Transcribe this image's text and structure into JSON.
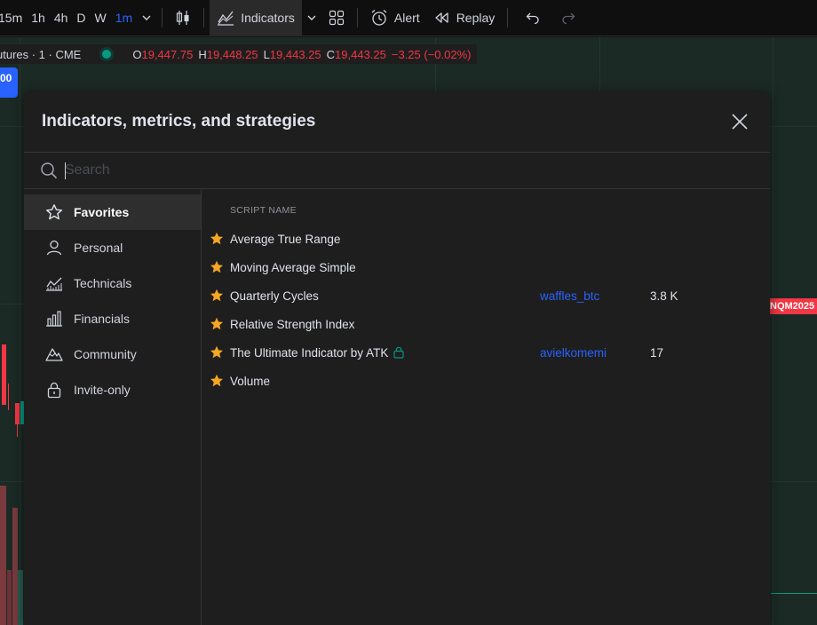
{
  "toolbar": {
    "timeframes": [
      "15m",
      "1h",
      "4h",
      "D",
      "W",
      "1m"
    ],
    "active_timeframe_index": 5,
    "indicators_label": "Indicators",
    "alert_label": "Alert",
    "replay_label": "Replay"
  },
  "chart": {
    "symbol": "utures · 1 · CME",
    "ohlc": {
      "o_key": "O",
      "o": "19,447.75",
      "h_key": "H",
      "h": "19,448.25",
      "l_key": "L",
      "l": "19,443.25",
      "c_key": "C",
      "c": "19,443.25",
      "change": "−3.25 (−0.02%)"
    },
    "left_badge": "00",
    "price_label": "NQM2025",
    "colors": {
      "up": "#089981",
      "down": "#f23645",
      "accent": "#2962ff"
    }
  },
  "dialog": {
    "title": "Indicators, metrics, and strategies",
    "search_placeholder": "Search",
    "sidebar": [
      {
        "label": "Favorites",
        "icon": "star-outline-icon"
      },
      {
        "label": "Personal",
        "icon": "user-icon"
      },
      {
        "label": "Technicals",
        "icon": "chart-line-icon"
      },
      {
        "label": "Financials",
        "icon": "bar-chart-icon"
      },
      {
        "label": "Community",
        "icon": "mountain-icon"
      },
      {
        "label": "Invite-only",
        "icon": "lock-icon"
      }
    ],
    "active_sidebar_index": 0,
    "column_header": "SCRIPT NAME",
    "scripts": [
      {
        "name": "Average True Range",
        "author": "",
        "users": "",
        "locked": false
      },
      {
        "name": "Moving Average Simple",
        "author": "",
        "users": "",
        "locked": false
      },
      {
        "name": "Quarterly Cycles",
        "author": "waffles_btc",
        "users": "3.8 K",
        "locked": false
      },
      {
        "name": "Relative Strength Index",
        "author": "",
        "users": "",
        "locked": false
      },
      {
        "name": "The Ultimate Indicator by ATK",
        "author": "avielkomemi",
        "users": "17",
        "locked": true
      },
      {
        "name": "Volume",
        "author": "",
        "users": "",
        "locked": false
      }
    ]
  }
}
